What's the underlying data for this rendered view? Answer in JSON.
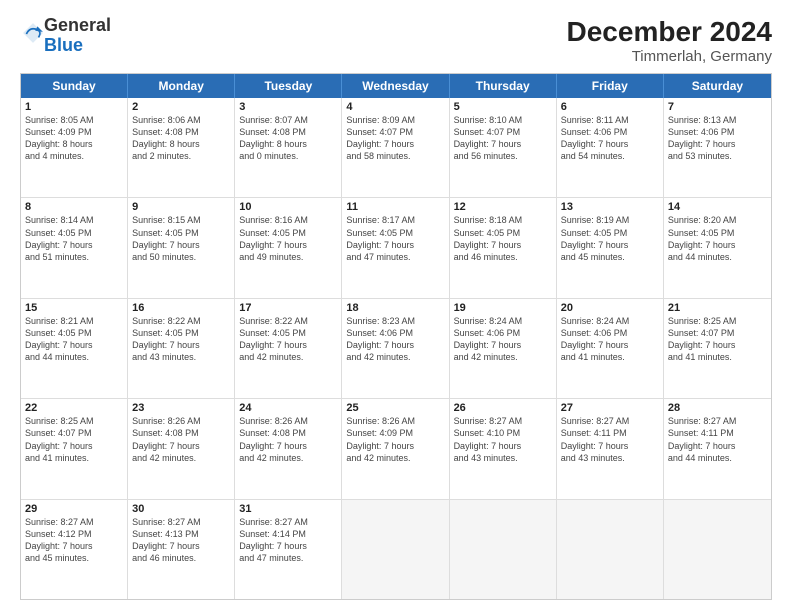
{
  "logo": {
    "line1": "General",
    "line2": "Blue"
  },
  "title": "December 2024",
  "subtitle": "Timmerlah, Germany",
  "weekdays": [
    "Sunday",
    "Monday",
    "Tuesday",
    "Wednesday",
    "Thursday",
    "Friday",
    "Saturday"
  ],
  "weeks": [
    [
      {
        "day": "1",
        "info": "Sunrise: 8:05 AM\nSunset: 4:09 PM\nDaylight: 8 hours\nand 4 minutes."
      },
      {
        "day": "2",
        "info": "Sunrise: 8:06 AM\nSunset: 4:08 PM\nDaylight: 8 hours\nand 2 minutes."
      },
      {
        "day": "3",
        "info": "Sunrise: 8:07 AM\nSunset: 4:08 PM\nDaylight: 8 hours\nand 0 minutes."
      },
      {
        "day": "4",
        "info": "Sunrise: 8:09 AM\nSunset: 4:07 PM\nDaylight: 7 hours\nand 58 minutes."
      },
      {
        "day": "5",
        "info": "Sunrise: 8:10 AM\nSunset: 4:07 PM\nDaylight: 7 hours\nand 56 minutes."
      },
      {
        "day": "6",
        "info": "Sunrise: 8:11 AM\nSunset: 4:06 PM\nDaylight: 7 hours\nand 54 minutes."
      },
      {
        "day": "7",
        "info": "Sunrise: 8:13 AM\nSunset: 4:06 PM\nDaylight: 7 hours\nand 53 minutes."
      }
    ],
    [
      {
        "day": "8",
        "info": "Sunrise: 8:14 AM\nSunset: 4:05 PM\nDaylight: 7 hours\nand 51 minutes."
      },
      {
        "day": "9",
        "info": "Sunrise: 8:15 AM\nSunset: 4:05 PM\nDaylight: 7 hours\nand 50 minutes."
      },
      {
        "day": "10",
        "info": "Sunrise: 8:16 AM\nSunset: 4:05 PM\nDaylight: 7 hours\nand 49 minutes."
      },
      {
        "day": "11",
        "info": "Sunrise: 8:17 AM\nSunset: 4:05 PM\nDaylight: 7 hours\nand 47 minutes."
      },
      {
        "day": "12",
        "info": "Sunrise: 8:18 AM\nSunset: 4:05 PM\nDaylight: 7 hours\nand 46 minutes."
      },
      {
        "day": "13",
        "info": "Sunrise: 8:19 AM\nSunset: 4:05 PM\nDaylight: 7 hours\nand 45 minutes."
      },
      {
        "day": "14",
        "info": "Sunrise: 8:20 AM\nSunset: 4:05 PM\nDaylight: 7 hours\nand 44 minutes."
      }
    ],
    [
      {
        "day": "15",
        "info": "Sunrise: 8:21 AM\nSunset: 4:05 PM\nDaylight: 7 hours\nand 44 minutes."
      },
      {
        "day": "16",
        "info": "Sunrise: 8:22 AM\nSunset: 4:05 PM\nDaylight: 7 hours\nand 43 minutes."
      },
      {
        "day": "17",
        "info": "Sunrise: 8:22 AM\nSunset: 4:05 PM\nDaylight: 7 hours\nand 42 minutes."
      },
      {
        "day": "18",
        "info": "Sunrise: 8:23 AM\nSunset: 4:06 PM\nDaylight: 7 hours\nand 42 minutes."
      },
      {
        "day": "19",
        "info": "Sunrise: 8:24 AM\nSunset: 4:06 PM\nDaylight: 7 hours\nand 42 minutes."
      },
      {
        "day": "20",
        "info": "Sunrise: 8:24 AM\nSunset: 4:06 PM\nDaylight: 7 hours\nand 41 minutes."
      },
      {
        "day": "21",
        "info": "Sunrise: 8:25 AM\nSunset: 4:07 PM\nDaylight: 7 hours\nand 41 minutes."
      }
    ],
    [
      {
        "day": "22",
        "info": "Sunrise: 8:25 AM\nSunset: 4:07 PM\nDaylight: 7 hours\nand 41 minutes."
      },
      {
        "day": "23",
        "info": "Sunrise: 8:26 AM\nSunset: 4:08 PM\nDaylight: 7 hours\nand 42 minutes."
      },
      {
        "day": "24",
        "info": "Sunrise: 8:26 AM\nSunset: 4:08 PM\nDaylight: 7 hours\nand 42 minutes."
      },
      {
        "day": "25",
        "info": "Sunrise: 8:26 AM\nSunset: 4:09 PM\nDaylight: 7 hours\nand 42 minutes."
      },
      {
        "day": "26",
        "info": "Sunrise: 8:27 AM\nSunset: 4:10 PM\nDaylight: 7 hours\nand 43 minutes."
      },
      {
        "day": "27",
        "info": "Sunrise: 8:27 AM\nSunset: 4:11 PM\nDaylight: 7 hours\nand 43 minutes."
      },
      {
        "day": "28",
        "info": "Sunrise: 8:27 AM\nSunset: 4:11 PM\nDaylight: 7 hours\nand 44 minutes."
      }
    ],
    [
      {
        "day": "29",
        "info": "Sunrise: 8:27 AM\nSunset: 4:12 PM\nDaylight: 7 hours\nand 45 minutes."
      },
      {
        "day": "30",
        "info": "Sunrise: 8:27 AM\nSunset: 4:13 PM\nDaylight: 7 hours\nand 46 minutes."
      },
      {
        "day": "31",
        "info": "Sunrise: 8:27 AM\nSunset: 4:14 PM\nDaylight: 7 hours\nand 47 minutes."
      },
      {
        "day": "",
        "info": ""
      },
      {
        "day": "",
        "info": ""
      },
      {
        "day": "",
        "info": ""
      },
      {
        "day": "",
        "info": ""
      }
    ]
  ]
}
